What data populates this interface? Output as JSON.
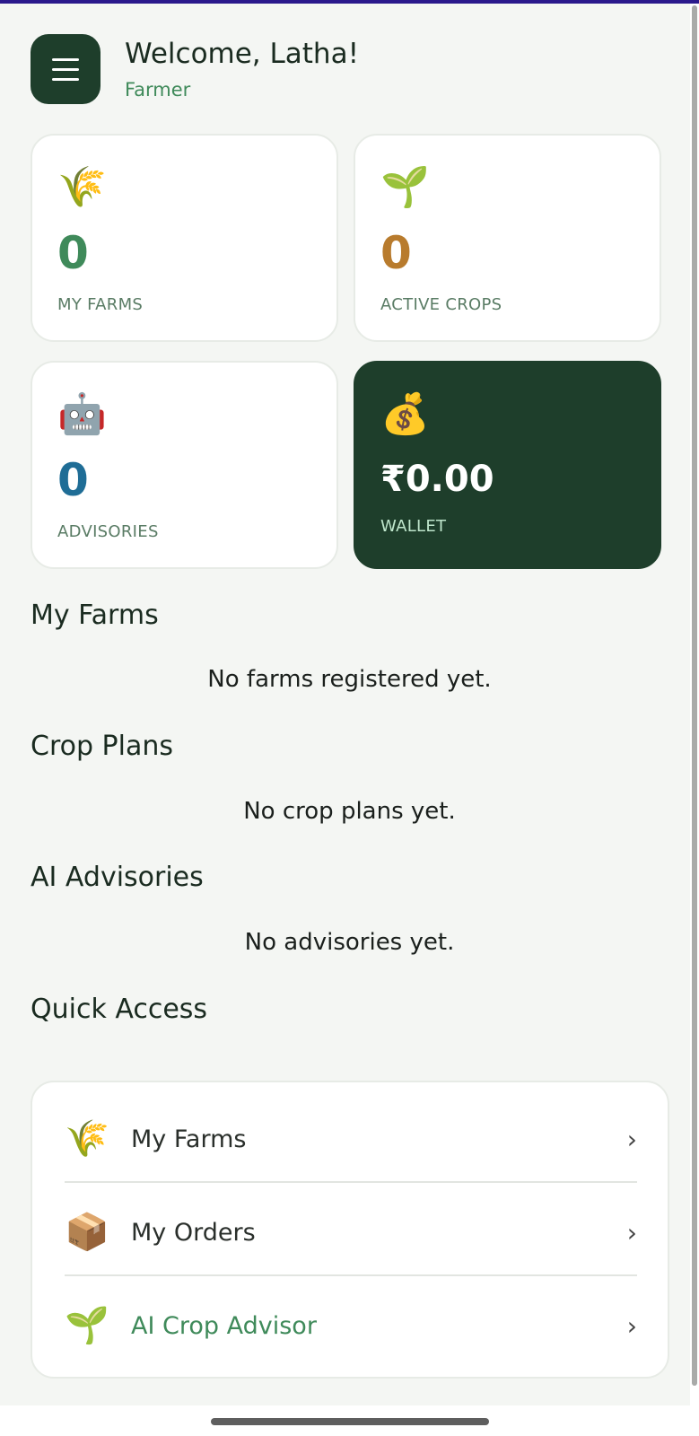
{
  "header": {
    "title": "Welcome, Latha!",
    "role": "Farmer"
  },
  "stats": [
    {
      "icon": "🌾",
      "icon_name": "rice-sheaf-icon",
      "value": "0",
      "label": "MY FARMS",
      "color": "#3f8a5a"
    },
    {
      "icon": "🌱",
      "icon_name": "seedling-icon",
      "value": "0",
      "label": "ACTIVE CROPS",
      "color": "#b87b2d"
    },
    {
      "icon": "🤖",
      "icon_name": "robot-icon",
      "value": "0",
      "label": "ADVISORIES",
      "color": "#1f6d96"
    },
    {
      "icon": "💰",
      "icon_name": "money-bag-icon",
      "value": "₹0.00",
      "label": "WALLET",
      "color": "#ffffff"
    }
  ],
  "sections": {
    "farms": {
      "title": "My Farms",
      "empty": "No farms registered yet."
    },
    "crops": {
      "title": "Crop Plans",
      "empty": "No crop plans yet."
    },
    "advisories": {
      "title": "AI Advisories",
      "empty": "No advisories yet."
    },
    "quick": {
      "title": "Quick Access"
    }
  },
  "quick_access": [
    {
      "icon": "🌾",
      "icon_name": "rice-sheaf-icon",
      "label": "My Farms",
      "chevron": "›"
    },
    {
      "icon": "📦",
      "icon_name": "package-icon",
      "label": "My Orders",
      "chevron": "›"
    },
    {
      "icon": "🌱",
      "icon_name": "seedling-icon",
      "label": "AI Crop Advisor",
      "chevron": "›"
    }
  ],
  "colors": {
    "brand_dark": "#1e3e2b",
    "accent_green": "#3f8a5a",
    "background": "#f4f6f3"
  }
}
